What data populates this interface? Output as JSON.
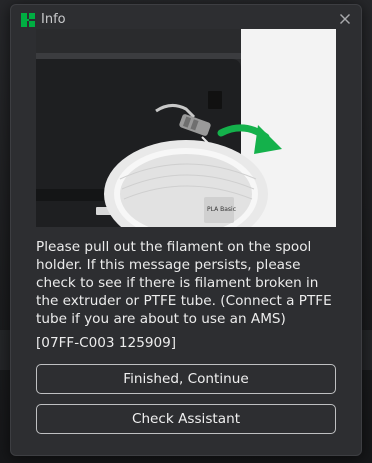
{
  "dialog": {
    "title": "Info",
    "close_icon": "close-icon",
    "logo_icon": "bambu-logo-icon",
    "logo_color": "#00ae42",
    "image_description": "printer-spool-illustration",
    "message": "Please pull out the filament on the spool holder. If this message persists, please check to see if there is filament broken in the extruder or PTFE tube. (Connect a PTFE tube if you are about to use an AMS)",
    "error_code": "[07FF-C003 125909]",
    "spool_label": "PLA Basic",
    "buttons": {
      "primary": "Finished, Continue",
      "secondary": "Check Assistant"
    },
    "arrow_color": "#14b14b"
  }
}
